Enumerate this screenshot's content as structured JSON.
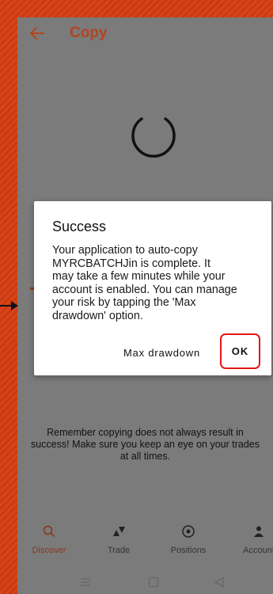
{
  "appbar": {
    "title": "Copy",
    "back_icon": "arrow-left-icon"
  },
  "loading": {
    "icon": "spinner-icon"
  },
  "reminder": {
    "line1": "Remember copying does not always result in",
    "line2": "success! Make sure you keep an eye on your trades",
    "line3": "at all times."
  },
  "dialog": {
    "title": "Success",
    "body": {
      "line1": "Your application to auto-copy",
      "line2": "MYRCBATCHJin is complete. It",
      "line3": "may take a few minutes while your",
      "line4": "account is enabled. You can manage",
      "line5": "your risk by tapping the 'Max",
      "line6": "drawdown' option."
    },
    "max_drawdown_label": "Max drawdown",
    "ok_label": "OK"
  },
  "bottom_nav": {
    "items": [
      {
        "label": "Discover",
        "icon": "search-icon",
        "active": true
      },
      {
        "label": "Trade",
        "icon": "trade-icon",
        "active": false
      },
      {
        "label": "Positions",
        "icon": "positions-icon",
        "active": false
      },
      {
        "label": "Account",
        "icon": "person-icon",
        "active": false
      }
    ]
  },
  "colors": {
    "accent": "#b4441f",
    "overlay_bg": "#7b7b7b",
    "highlight": "#e01818",
    "background_stripes": "#d8441a"
  }
}
